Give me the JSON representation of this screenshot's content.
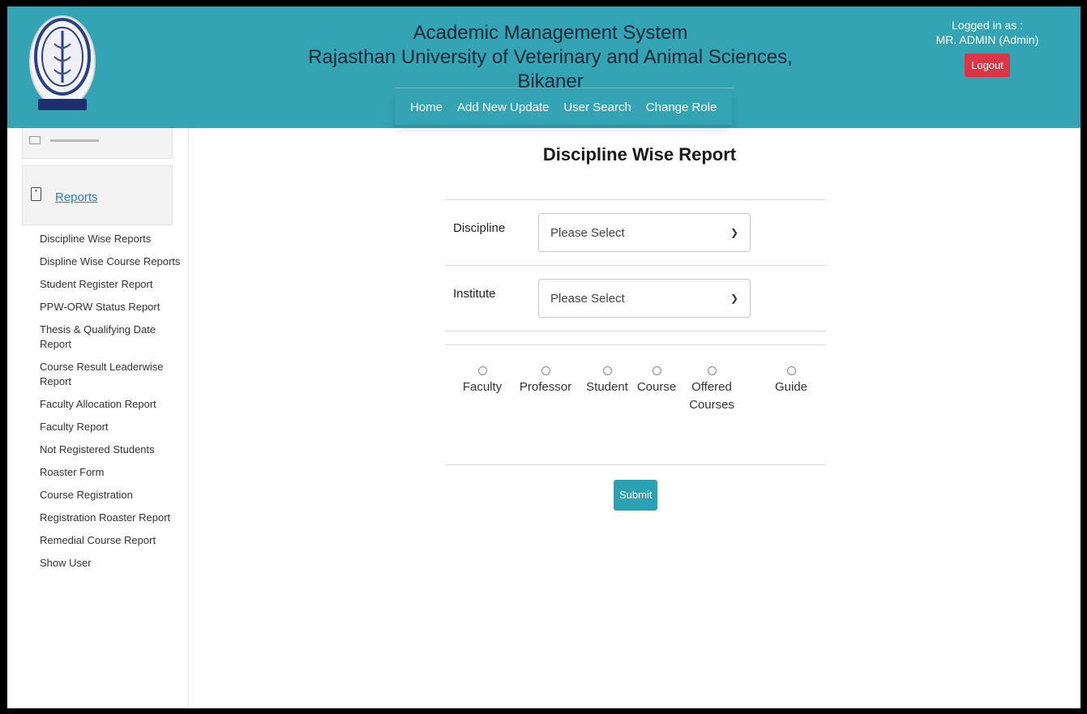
{
  "header": {
    "title_line1": "Academic Management System",
    "title_line2": "Rajasthan University of Veterinary and Animal Sciences, Bikaner",
    "nav": [
      "Home",
      "Add New Update",
      "User Search",
      "Change Role"
    ],
    "login_label": "Logged in as :",
    "login_user": "MR. ADMIN (Admin)",
    "logout_label": "Logout",
    "colors": {
      "header_bg": "#34a3b3",
      "logout_bg": "#dc3545"
    }
  },
  "sidebar": {
    "section_icon": "document-icon",
    "section_label": "Reports",
    "items": [
      "Discipline Wise Reports",
      "Displine Wise Course Reports",
      "Student Register Report",
      "PPW-ORW Status Report",
      "Thesis & Qualifying Date Report",
      "Course Result Leaderwise Report",
      "Faculty Allocation Report",
      "Faculty Report",
      "Not Registered Students",
      "Roaster Form",
      "Course Registration",
      "Registration Roaster Report",
      "Remedial Course Report",
      "Show User"
    ]
  },
  "main": {
    "title": "Discipline Wise Report",
    "discipline_label": "Discipline",
    "discipline_value": "Please Select",
    "institute_label": "Institute",
    "institute_value": "Please Select",
    "radios": [
      "Faculty",
      "Professor",
      "Student",
      "Course",
      "Offered Courses",
      "Guide"
    ],
    "submit_label": "Submit"
  }
}
